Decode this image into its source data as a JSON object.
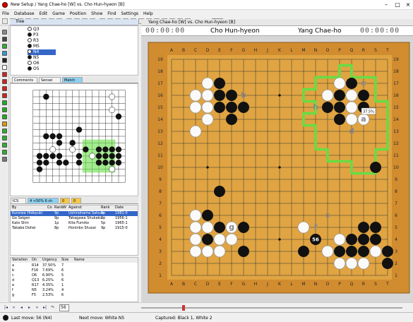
{
  "window": {
    "title": "New Setup / Yang Chae-ho [W] vs. Cho Hun-hyeon [B]"
  },
  "menu": [
    "File",
    "Database",
    "Edit",
    "Game",
    "Position",
    "Show",
    "Find",
    "Settings",
    "Help"
  ],
  "toolbar": {
    "move_count": "5"
  },
  "tree": {
    "title": "Tree",
    "items": [
      {
        "label": "Q3",
        "color": "white"
      },
      {
        "label": "P3",
        "color": "black"
      },
      {
        "label": "R3",
        "color": "white"
      },
      {
        "label": "M5",
        "color": "black"
      },
      {
        "label": "N4",
        "color": "white",
        "selected": true
      },
      {
        "label": "N5",
        "color": "black"
      },
      {
        "label": "O6",
        "color": "white"
      },
      {
        "label": "O5",
        "color": "black"
      }
    ]
  },
  "tabs": [
    "Comments",
    "Sensei",
    "Match"
  ],
  "small_board": {
    "black": [
      [
        2,
        1
      ],
      [
        13,
        4
      ],
      [
        7,
        6
      ],
      [
        2,
        7
      ],
      [
        3,
        7
      ],
      [
        4,
        8
      ],
      [
        8,
        9
      ],
      [
        1,
        10
      ],
      [
        2,
        10
      ],
      [
        3,
        10
      ],
      [
        4,
        10
      ],
      [
        7,
        10
      ],
      [
        1,
        11
      ],
      [
        2,
        11
      ],
      [
        4,
        11
      ],
      [
        5,
        11
      ],
      [
        7,
        11
      ],
      [
        10,
        11
      ],
      [
        1,
        12
      ],
      [
        10,
        9
      ],
      [
        11,
        9
      ],
      [
        12,
        9
      ],
      [
        13,
        9
      ],
      [
        10,
        10
      ],
      [
        11,
        10
      ],
      [
        12,
        10
      ],
      [
        13,
        10
      ],
      [
        10,
        11
      ],
      [
        11,
        11
      ],
      [
        12,
        11
      ],
      [
        13,
        11
      ],
      [
        6,
        8
      ],
      [
        4,
        7
      ]
    ],
    "white": [
      [
        12,
        1
      ],
      [
        12,
        3
      ],
      [
        3,
        9
      ],
      [
        6,
        9
      ],
      [
        9,
        10
      ],
      [
        12,
        12
      ]
    ]
  },
  "match_tabs": [
    "ICS",
    "4 <50% 6 ch",
    "0",
    "0"
  ],
  "match": {
    "headers": [
      "By",
      "Co",
      "Rank",
      "W",
      "Against",
      "Rank",
      "Date"
    ],
    "rows": [
      [
        "Kuroiwa Hideyuki",
        "",
        "9p",
        "",
        "Ushinohama Satsuo",
        "9p",
        "1981-0"
      ],
      [
        "Go Seigen",
        "",
        "9p",
        "",
        "Takagawa Shukaku",
        "9p",
        "1956-1"
      ],
      [
        "Kato Shin",
        "",
        "1p",
        "",
        "Kita Fumiko",
        "5p",
        "1965-1"
      ],
      [
        "Takabe Dohei",
        "",
        "8p",
        "",
        "Honinbo Shusai",
        "9p",
        "1915-0"
      ]
    ]
  },
  "variations": {
    "headers": [
      "Variation",
      "On",
      "Urgency",
      "Size",
      "Name"
    ],
    "rows": [
      [
        "a",
        "R14",
        "37.50%",
        "7",
        ""
      ],
      [
        "b",
        "F16",
        "7.69%",
        "6",
        ""
      ],
      [
        "c",
        "O6",
        "6.90%",
        "5",
        ""
      ],
      [
        "d",
        "Q13",
        "6.25%",
        "6",
        ""
      ],
      [
        "e",
        "R17",
        "4.35%",
        "1",
        ""
      ],
      [
        "f",
        "N5",
        "3.24%",
        "4",
        ""
      ],
      [
        "g",
        "F5",
        "2.53%",
        "6",
        ""
      ]
    ]
  },
  "board_window_title": "Yang Chae-ho [W] vs. Cho Hun-hyeon [B]",
  "players": {
    "black": "Cho Hun-hyeon",
    "white": "Yang Chae-ho",
    "black_clock": "00:00:00",
    "white_clock": "00:00:00"
  },
  "board": {
    "col_labels": [
      "A",
      "B",
      "C",
      "D",
      "E",
      "F",
      "G",
      "H",
      "J",
      "K",
      "L",
      "M",
      "N",
      "O",
      "P",
      "Q",
      "R",
      "S",
      "T"
    ],
    "row_labels": [
      "19",
      "18",
      "17",
      "16",
      "15",
      "14",
      "13",
      "12",
      "11",
      "10",
      "9",
      "8",
      "7",
      "6",
      "5",
      "4",
      "3",
      "2",
      "1"
    ],
    "black": [
      [
        "E17"
      ],
      [
        "D16"
      ],
      [
        "E16"
      ],
      [
        "F16"
      ],
      [
        "E15"
      ],
      [
        "D15"
      ],
      [
        "F15"
      ],
      [
        "G15"
      ],
      [
        "F14"
      ],
      [
        "Q17"
      ],
      [
        "P16"
      ],
      [
        "O16"
      ],
      [
        "R16"
      ],
      [
        "R15"
      ],
      [
        "P15"
      ],
      [
        "O15"
      ],
      [
        "P14"
      ],
      [
        "E8"
      ],
      [
        "S10"
      ],
      [
        "S5"
      ],
      [
        "E5"
      ],
      [
        "D6"
      ],
      [
        "G5"
      ],
      [
        "D4"
      ],
      [
        "G3"
      ],
      [
        "M3"
      ],
      [
        "R5"
      ],
      [
        "R4"
      ],
      [
        "Q4"
      ],
      [
        "S4"
      ],
      [
        "R3"
      ],
      [
        "T3"
      ],
      [
        "T2"
      ],
      [
        "P3"
      ],
      [
        "Q3"
      ],
      [
        "N4"
      ]
    ],
    "white": [
      [
        "D17"
      ],
      [
        "D16w"
      ],
      [
        "C16"
      ],
      [
        "D15w"
      ],
      [
        "C15"
      ],
      [
        "D14"
      ],
      [
        "C13"
      ],
      [
        "P17"
      ],
      [
        "Q16"
      ],
      [
        "O16w"
      ],
      [
        "Q15"
      ],
      [
        "Q14"
      ],
      [
        "R14w"
      ],
      [
        "C6"
      ],
      [
        "D5"
      ],
      [
        "C5"
      ],
      [
        "F5"
      ],
      [
        "E4"
      ],
      [
        "F4"
      ],
      [
        "C4"
      ],
      [
        "C3"
      ],
      [
        "D3"
      ],
      [
        "E3"
      ],
      [
        "M5"
      ],
      [
        "P4"
      ],
      [
        "Q2"
      ],
      [
        "O3"
      ],
      [
        "P2"
      ],
      [
        "R2"
      ],
      [
        "S3"
      ]
    ],
    "variation_labels": [
      {
        "t": "a",
        "c": "R14"
      },
      {
        "t": "b",
        "c": "G16"
      },
      {
        "t": "c",
        "c": "O6"
      },
      {
        "t": "d",
        "c": "Q13"
      },
      {
        "t": "e",
        "c": "R17"
      },
      {
        "t": "f",
        "c": "N5"
      },
      {
        "t": "g",
        "c": "F5"
      },
      {
        "t": "h",
        "c": "N15"
      }
    ],
    "last_move": {
      "point": "N4",
      "number": "56"
    },
    "tooltip": "37.5%"
  },
  "nav": {
    "move_number": "56"
  },
  "status": {
    "last_move": "Last move: 56 (N4)",
    "next_move": "Next move: White N5",
    "captured": "Captured: Black 1, White 2"
  },
  "colors": {
    "board": "#e0a442",
    "frame": "#d18c30",
    "match_hilite": "#3466c8",
    "territory": "#66dd44"
  }
}
